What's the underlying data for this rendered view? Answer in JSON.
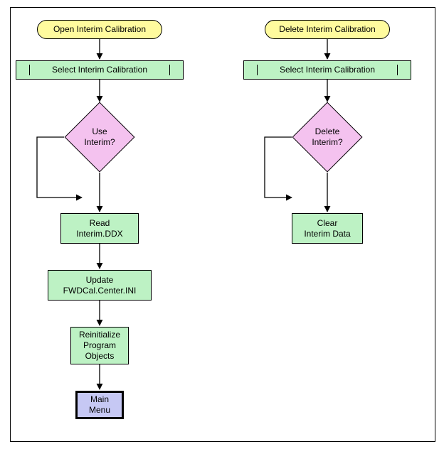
{
  "left": {
    "start": "Open Interim Calibration",
    "select": "Select Interim Calibration",
    "decision": "Use\nInterim?",
    "step1": "Read\nInterim.DDX",
    "step2": "Update\nFWDCal.Center.INI",
    "step3": "Reinitialize\nProgram\nObjects",
    "end": "Main\nMenu"
  },
  "right": {
    "start": "Delete Interim Calibration",
    "select": "Select Interim Calibration",
    "decision": "Delete\nInterim?",
    "step1": "Clear\nInterim Data"
  }
}
